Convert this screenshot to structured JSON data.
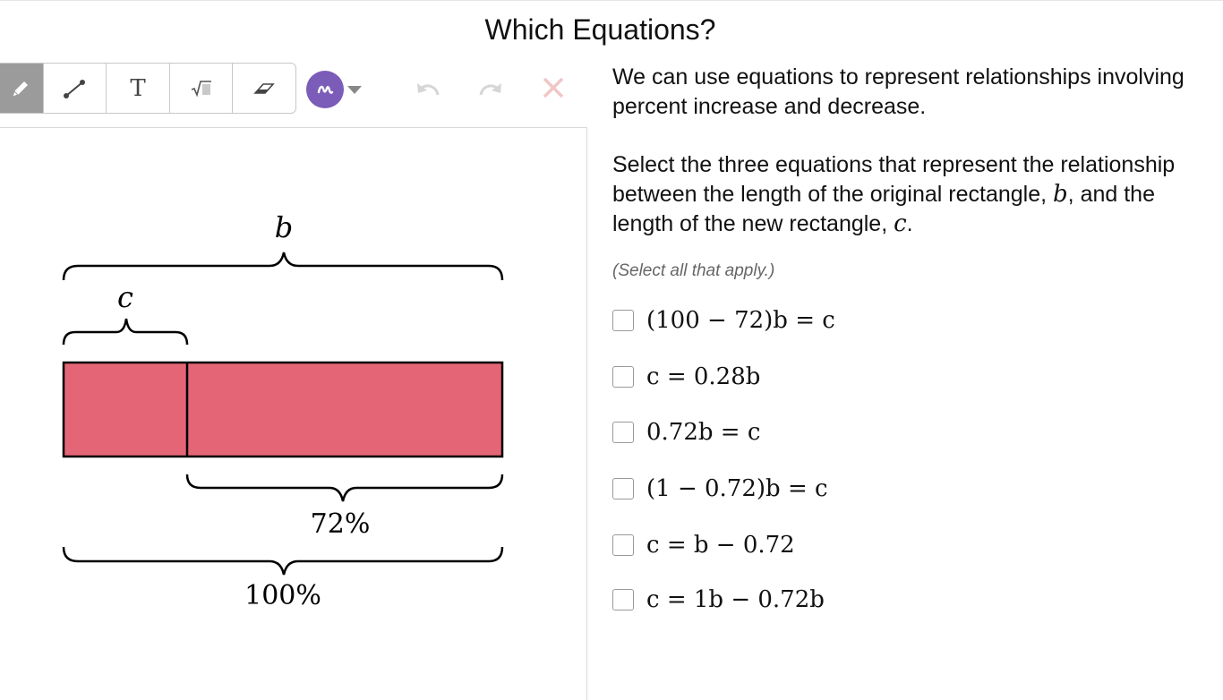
{
  "page": {
    "title": "Which Equations?"
  },
  "toolbar": {
    "tools": [
      {
        "name": "pencil-icon",
        "label": ""
      },
      {
        "name": "line-icon",
        "label": ""
      },
      {
        "name": "text-icon",
        "label": "T"
      },
      {
        "name": "math-icon",
        "label": ""
      },
      {
        "name": "eraser-icon",
        "label": ""
      }
    ],
    "active_tool": "pencil",
    "ink_color": "#7b5cb8",
    "action_icons": [
      "undo-icon",
      "redo-icon",
      "close-icon"
    ]
  },
  "diagram": {
    "top_brace_label": "b",
    "small_brace_label": "c",
    "middle_brace_label": "72%",
    "bottom_brace_label": "100%",
    "rect_fill": "#e46676",
    "segment_fraction": 0.28
  },
  "instructions": {
    "p1": "We can use equations to represent relationships involving percent increase and decrease.",
    "p2_a": "Select the three equations that represent the relationship between the length of the original rectangle, ",
    "p2_var_b": "b",
    "p2_b": ", and the length of the new rectangle, ",
    "p2_var_c": "c",
    "p2_c": ".",
    "hint": "(Select all that apply.)"
  },
  "options": [
    {
      "equation": "(100 − 72)b = c",
      "checked": false
    },
    {
      "equation": "c = 0.28b",
      "checked": false
    },
    {
      "equation": "0.72b = c",
      "checked": false
    },
    {
      "equation": "(1 − 0.72)b = c",
      "checked": false
    },
    {
      "equation": "c = b − 0.72",
      "checked": false
    },
    {
      "equation": "c = 1b − 0.72b",
      "checked": false
    }
  ]
}
